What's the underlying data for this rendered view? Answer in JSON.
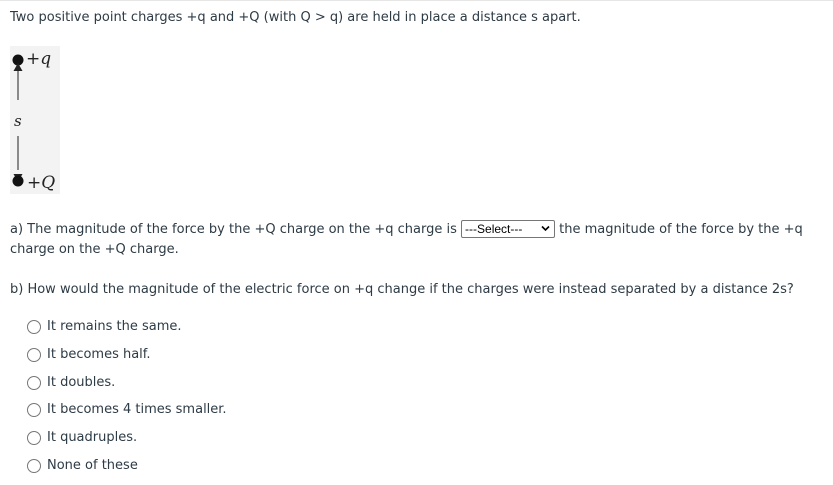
{
  "question": {
    "intro": "Two positive point charges +q and +Q (with Q > q) are held in place a distance s apart.",
    "figure": {
      "label_top": "+q",
      "label_distance": "s",
      "label_bottom": "+Q"
    },
    "part_a": {
      "text_before": "a) The magnitude of the force by the +Q charge on the +q charge is",
      "select_value": "---Select---",
      "text_after": "the magnitude of the force by the +q charge on the +Q charge."
    },
    "part_b": {
      "prompt": "b) How would the magnitude of the electric force on +q change if the charges were instead separated by a distance 2s?",
      "options": [
        "It remains the same.",
        "It becomes half.",
        "It doubles.",
        "It becomes 4 times smaller.",
        "It quadruples.",
        "None of these"
      ]
    }
  }
}
